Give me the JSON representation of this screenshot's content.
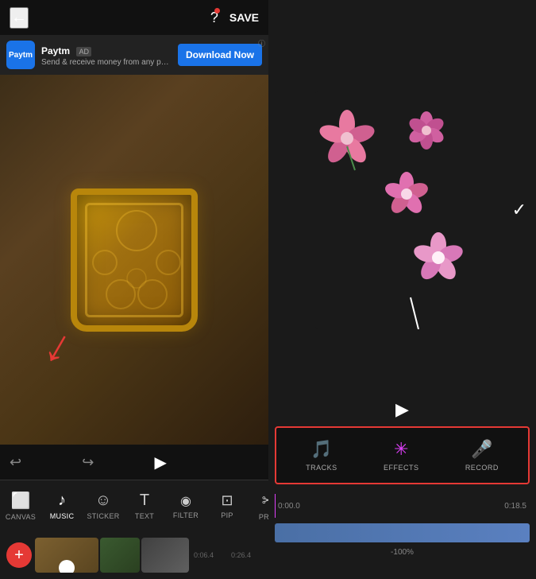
{
  "left": {
    "back_label": "←",
    "help_label": "?",
    "save_label": "SAVE",
    "ad": {
      "logo_text": "Paytm",
      "title": "Paytm",
      "tag": "AD",
      "subtitle": "Send & receive money from any phone ...",
      "download_label": "Download Now",
      "info_label": "ⓘ"
    },
    "toolbar": {
      "undo": "↩",
      "redo": "↪",
      "play": "▶"
    },
    "icons": [
      {
        "sym": "⬜",
        "label": "CANVAS"
      },
      {
        "sym": "♪",
        "label": "MUSIC",
        "active": true
      },
      {
        "sym": "☺",
        "label": "STICKER"
      },
      {
        "sym": "T",
        "label": "TEXT"
      },
      {
        "sym": "◉",
        "label": "FILTER"
      },
      {
        "sym": "⊡",
        "label": "PIP"
      },
      {
        "sym": "✂",
        "label": "PRI..."
      }
    ],
    "add_label": "+",
    "timeline": {
      "times": [
        "0:06.4",
        "0:26.4"
      ]
    }
  },
  "right": {
    "checkmark": "✓",
    "play_label": "▶",
    "actions": [
      {
        "sym": "♪+",
        "label": "TRACKS",
        "type": "tracks"
      },
      {
        "sym": "✳",
        "label": "EFFECTS",
        "type": "effects"
      },
      {
        "sym": "🎤",
        "label": "RECORD",
        "type": "record"
      }
    ],
    "timeline": {
      "progress": "0:00.0",
      "duration": "0:18.5",
      "zoom": "-100%"
    }
  }
}
